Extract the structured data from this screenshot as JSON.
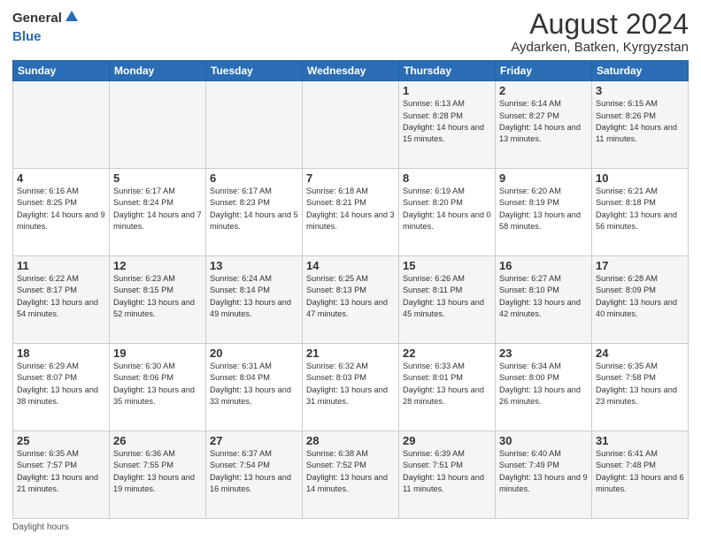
{
  "logo": {
    "general": "General",
    "blue": "Blue"
  },
  "title": "August 2024",
  "subtitle": "Aydarken, Batken, Kyrgyzstan",
  "weekdays": [
    "Sunday",
    "Monday",
    "Tuesday",
    "Wednesday",
    "Thursday",
    "Friday",
    "Saturday"
  ],
  "footer": "Daylight hours",
  "weeks": [
    [
      {
        "day": "",
        "info": ""
      },
      {
        "day": "",
        "info": ""
      },
      {
        "day": "",
        "info": ""
      },
      {
        "day": "",
        "info": ""
      },
      {
        "day": "1",
        "info": "Sunrise: 6:13 AM\nSunset: 8:28 PM\nDaylight: 14 hours and 15 minutes."
      },
      {
        "day": "2",
        "info": "Sunrise: 6:14 AM\nSunset: 8:27 PM\nDaylight: 14 hours and 13 minutes."
      },
      {
        "day": "3",
        "info": "Sunrise: 6:15 AM\nSunset: 8:26 PM\nDaylight: 14 hours and 11 minutes."
      }
    ],
    [
      {
        "day": "4",
        "info": "Sunrise: 6:16 AM\nSunset: 8:25 PM\nDaylight: 14 hours and 9 minutes."
      },
      {
        "day": "5",
        "info": "Sunrise: 6:17 AM\nSunset: 8:24 PM\nDaylight: 14 hours and 7 minutes."
      },
      {
        "day": "6",
        "info": "Sunrise: 6:17 AM\nSunset: 8:23 PM\nDaylight: 14 hours and 5 minutes."
      },
      {
        "day": "7",
        "info": "Sunrise: 6:18 AM\nSunset: 8:21 PM\nDaylight: 14 hours and 3 minutes."
      },
      {
        "day": "8",
        "info": "Sunrise: 6:19 AM\nSunset: 8:20 PM\nDaylight: 14 hours and 0 minutes."
      },
      {
        "day": "9",
        "info": "Sunrise: 6:20 AM\nSunset: 8:19 PM\nDaylight: 13 hours and 58 minutes."
      },
      {
        "day": "10",
        "info": "Sunrise: 6:21 AM\nSunset: 8:18 PM\nDaylight: 13 hours and 56 minutes."
      }
    ],
    [
      {
        "day": "11",
        "info": "Sunrise: 6:22 AM\nSunset: 8:17 PM\nDaylight: 13 hours and 54 minutes."
      },
      {
        "day": "12",
        "info": "Sunrise: 6:23 AM\nSunset: 8:15 PM\nDaylight: 13 hours and 52 minutes."
      },
      {
        "day": "13",
        "info": "Sunrise: 6:24 AM\nSunset: 8:14 PM\nDaylight: 13 hours and 49 minutes."
      },
      {
        "day": "14",
        "info": "Sunrise: 6:25 AM\nSunset: 8:13 PM\nDaylight: 13 hours and 47 minutes."
      },
      {
        "day": "15",
        "info": "Sunrise: 6:26 AM\nSunset: 8:11 PM\nDaylight: 13 hours and 45 minutes."
      },
      {
        "day": "16",
        "info": "Sunrise: 6:27 AM\nSunset: 8:10 PM\nDaylight: 13 hours and 42 minutes."
      },
      {
        "day": "17",
        "info": "Sunrise: 6:28 AM\nSunset: 8:09 PM\nDaylight: 13 hours and 40 minutes."
      }
    ],
    [
      {
        "day": "18",
        "info": "Sunrise: 6:29 AM\nSunset: 8:07 PM\nDaylight: 13 hours and 38 minutes."
      },
      {
        "day": "19",
        "info": "Sunrise: 6:30 AM\nSunset: 8:06 PM\nDaylight: 13 hours and 35 minutes."
      },
      {
        "day": "20",
        "info": "Sunrise: 6:31 AM\nSunset: 8:04 PM\nDaylight: 13 hours and 33 minutes."
      },
      {
        "day": "21",
        "info": "Sunrise: 6:32 AM\nSunset: 8:03 PM\nDaylight: 13 hours and 31 minutes."
      },
      {
        "day": "22",
        "info": "Sunrise: 6:33 AM\nSunset: 8:01 PM\nDaylight: 13 hours and 28 minutes."
      },
      {
        "day": "23",
        "info": "Sunrise: 6:34 AM\nSunset: 8:00 PM\nDaylight: 13 hours and 26 minutes."
      },
      {
        "day": "24",
        "info": "Sunrise: 6:35 AM\nSunset: 7:58 PM\nDaylight: 13 hours and 23 minutes."
      }
    ],
    [
      {
        "day": "25",
        "info": "Sunrise: 6:35 AM\nSunset: 7:57 PM\nDaylight: 13 hours and 21 minutes."
      },
      {
        "day": "26",
        "info": "Sunrise: 6:36 AM\nSunset: 7:55 PM\nDaylight: 13 hours and 19 minutes."
      },
      {
        "day": "27",
        "info": "Sunrise: 6:37 AM\nSunset: 7:54 PM\nDaylight: 13 hours and 16 minutes."
      },
      {
        "day": "28",
        "info": "Sunrise: 6:38 AM\nSunset: 7:52 PM\nDaylight: 13 hours and 14 minutes."
      },
      {
        "day": "29",
        "info": "Sunrise: 6:39 AM\nSunset: 7:51 PM\nDaylight: 13 hours and 11 minutes."
      },
      {
        "day": "30",
        "info": "Sunrise: 6:40 AM\nSunset: 7:49 PM\nDaylight: 13 hours and 9 minutes."
      },
      {
        "day": "31",
        "info": "Sunrise: 6:41 AM\nSunset: 7:48 PM\nDaylight: 13 hours and 6 minutes."
      }
    ]
  ]
}
